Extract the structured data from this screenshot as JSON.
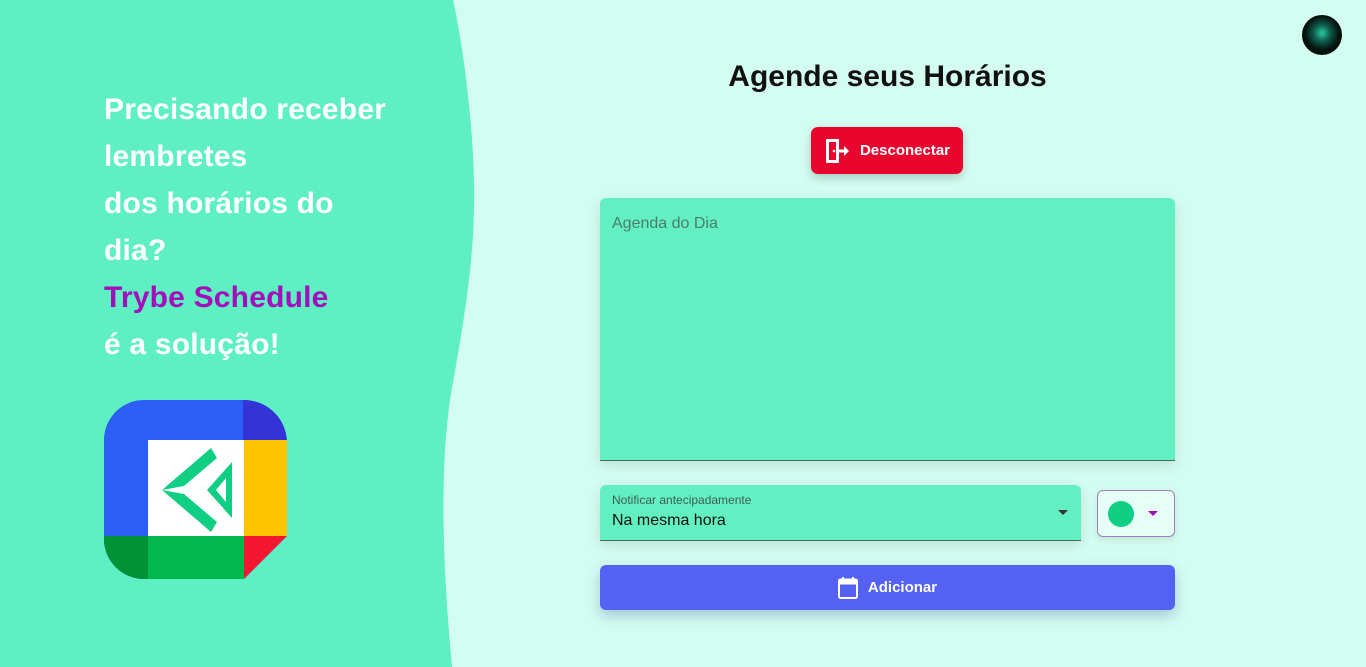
{
  "hero": {
    "line1": "Precisando receber",
    "line2": "lembretes",
    "line3": "dos horários do",
    "line4": "dia?",
    "brand": "Trybe Schedule",
    "line6": "é a solução!"
  },
  "main": {
    "title": "Agende seus Horários",
    "logout_label": "Desconectar",
    "agenda_placeholder": "Agenda do Dia",
    "notify": {
      "label": "Notificar antecipadamente",
      "value": "Na mesma hora"
    },
    "color_picker": {
      "selected_color": "#10cf85"
    },
    "add_label": "Adicionar"
  },
  "colors": {
    "left_panel": "#5eefc3",
    "page_bg": "#d4fdf1",
    "brand_text": "#a40dbc",
    "logout": "#e8062f",
    "add": "#5461f2"
  },
  "icons": {
    "logout": "exit-door-icon",
    "add": "calendar-icon",
    "logo": "trybe-schedule-logo",
    "avatar": "user-avatar"
  }
}
